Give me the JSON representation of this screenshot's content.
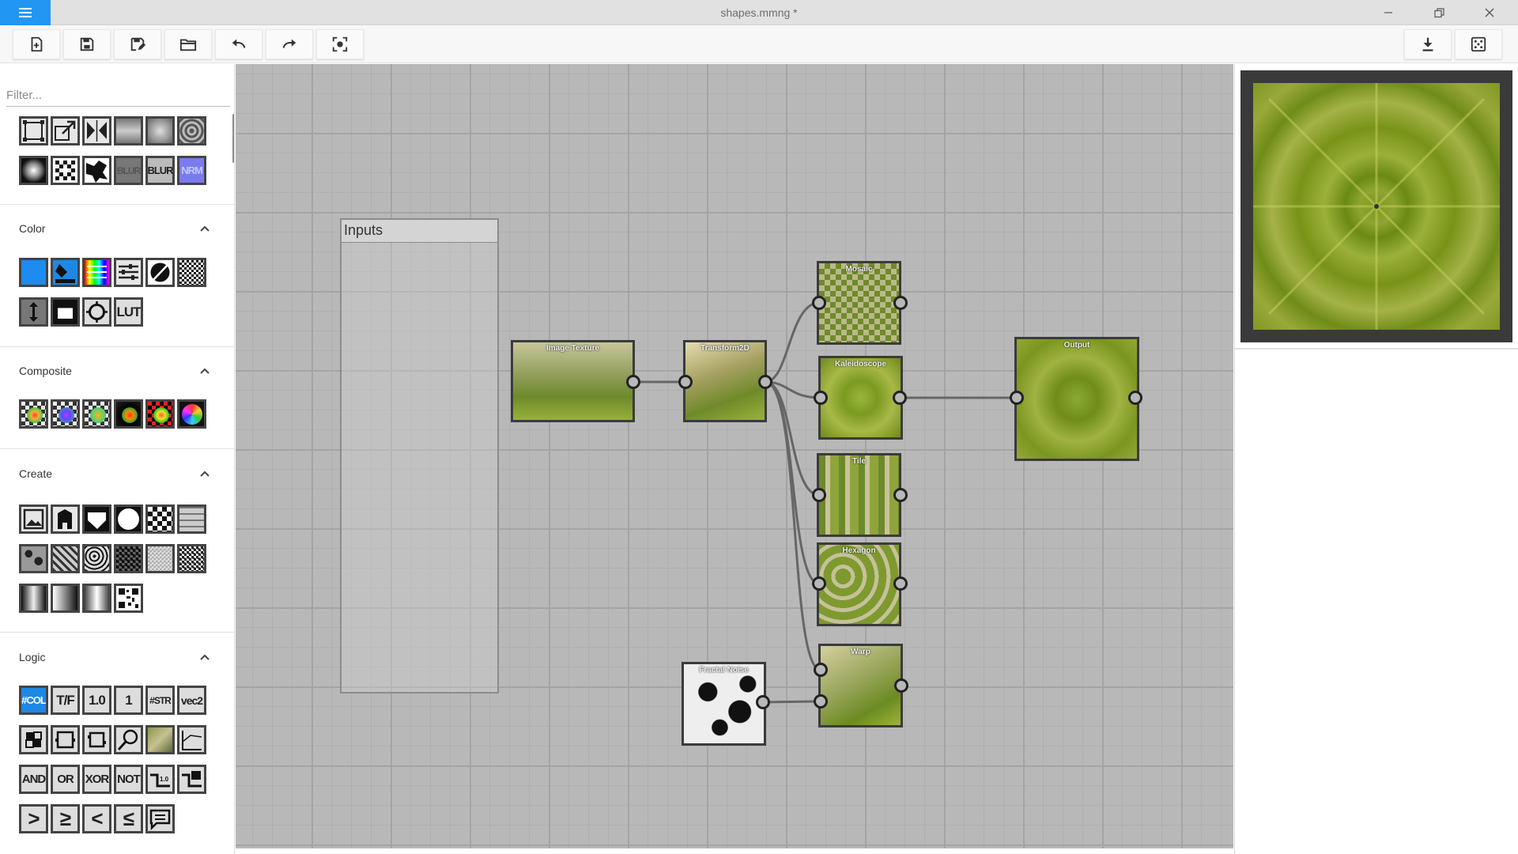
{
  "window": {
    "title": "shapes.mmng *"
  },
  "toolbar": {
    "items": [
      "new-file-icon",
      "save-icon",
      "save-as-icon",
      "open-folder-icon",
      "undo-icon",
      "redo-icon",
      "fit-view-icon",
      "download-icon",
      "randomize-icon"
    ]
  },
  "sidebar": {
    "filter_placeholder": "Filter...",
    "sections": [
      {
        "title": "Color",
        "icons": [
          "solid-color-icon",
          "fill-bucket-icon",
          "color-balance-icon",
          "levels-icon",
          "invert-icon",
          "dither-icon",
          "brightness-contrast-icon",
          "threshold-icon",
          "exposure-icon",
          "lut-icon"
        ]
      },
      {
        "title": "Composite",
        "icons": [
          "blend-normal-icon",
          "blend-multiply-icon",
          "blend-screen-icon",
          "blend-difference-icon",
          "blend-overlay-icon",
          "color-wheel-icon"
        ]
      },
      {
        "title": "Create",
        "icons": [
          "image-icon",
          "text-icon",
          "polygon-icon",
          "circle-icon",
          "checker-icon",
          "brick-icon",
          "noise-icon",
          "cells-icon",
          "voronoi-icon",
          "fractal-icon",
          "perlin-icon",
          "worley-icon",
          "gradient-linear-icon",
          "gradient-radial-icon",
          "gradient-mirror-icon",
          "qr-icon"
        ]
      },
      {
        "title": "Logic",
        "icons": [
          "color-param-icon",
          "bool-param-icon",
          "float-param-icon",
          "int-param-icon",
          "string-param-icon",
          "vec2-param-icon",
          "switch-icon",
          "frame-icon",
          "crop-icon",
          "search-icon",
          "preview-icon",
          "graph-icon",
          "and-icon",
          "or-icon",
          "xor-icon",
          "not-icon",
          "if-value-icon",
          "if-image-icon",
          "greater-icon",
          "greater-equal-icon",
          "less-icon",
          "less-equal-icon",
          "comment-icon"
        ]
      }
    ],
    "text_icons": {
      "blur": "BLUR",
      "nrm": "NRM",
      "lut": "LUT",
      "col": "#COL",
      "tf": "T/F",
      "flt": "1.0",
      "int": "1",
      "str": "#STR",
      "vec2": "vec2",
      "and": "AND",
      "or": "OR",
      "xor": "XOR",
      "not": "NOT",
      "gt": ">",
      "ge": "≥",
      "lt": "<",
      "le": "≤"
    }
  },
  "canvas": {
    "frame_title": "Inputs",
    "nodes": {
      "image_texture": "Image Texture",
      "transform2d": "Transform2D",
      "mosaic": "Mosaic",
      "kaleidoscope": "Kaleidoscope",
      "tile": "Tile",
      "hexagon": "Hexagon",
      "warp": "Warp",
      "fractal_noise": "Fractal Noise",
      "output": "Output"
    }
  },
  "colors": {
    "accent": "#2196f3",
    "canvas_bg": "#b8b8b8",
    "node_border": "#3b3b3b"
  }
}
